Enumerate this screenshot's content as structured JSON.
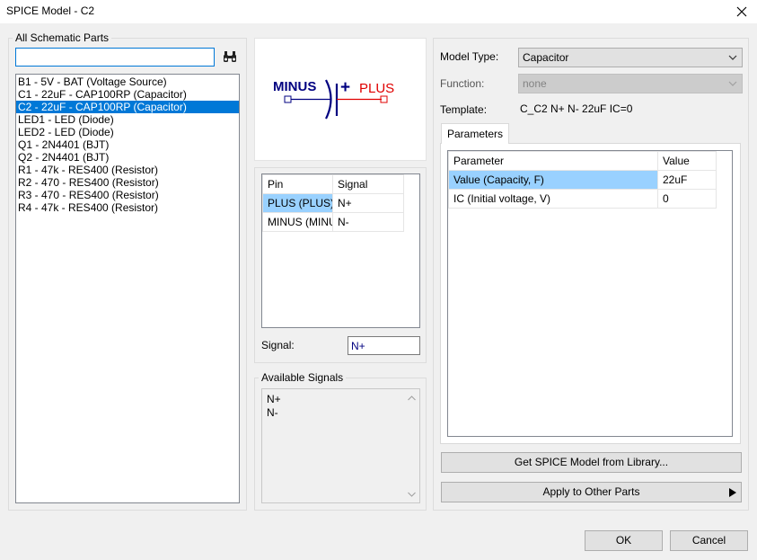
{
  "window": {
    "title": "SPICE Model - C2"
  },
  "left_panel": {
    "label": "All Schematic Parts",
    "search_value": "",
    "parts": [
      "B1 - 5V - BAT (Voltage Source)",
      "C1 - 22uF - CAP100RP (Capacitor)",
      "C2 - 22uF - CAP100RP (Capacitor)",
      "LED1 - LED (Diode)",
      "LED2 - LED (Diode)",
      "Q1 - 2N4401 (BJT)",
      "Q2 - 2N4401 (BJT)",
      "R1 - 47k - RES400 (Resistor)",
      "R2 - 470 - RES400 (Resistor)",
      "R3 - 470 - RES400 (Resistor)",
      "R4 - 47k - RES400 (Resistor)"
    ],
    "selected_index": 2
  },
  "symbol": {
    "minus_label": "MINUS",
    "plus_label": "PLUS",
    "plus_sign": "+"
  },
  "pins": {
    "columns": [
      "Pin",
      "Signal"
    ],
    "rows": [
      {
        "pin": "PLUS (PLUS)",
        "signal": "N+"
      },
      {
        "pin": "MINUS (MINUS)",
        "signal": "N-"
      }
    ],
    "signal_label": "Signal:",
    "signal_value": "N+"
  },
  "available_signals": {
    "label": "Available Signals",
    "items": [
      "N+",
      "N-"
    ]
  },
  "model": {
    "model_type_label": "Model Type:",
    "model_type_value": "Capacitor",
    "function_label": "Function:",
    "function_value": "none",
    "template_label": "Template:",
    "template_value": "C_C2 N+ N- 22uF IC=0"
  },
  "parameters": {
    "tab_label": "Parameters",
    "columns": [
      "Parameter",
      "Value"
    ],
    "rows": [
      {
        "name": "Value (Capacity, F)",
        "value": "22uF"
      },
      {
        "name": "IC (Initial voltage, V)",
        "value": "0"
      }
    ]
  },
  "buttons": {
    "get_model": "Get SPICE Model from Library...",
    "apply_other": "Apply to Other Parts",
    "ok": "OK",
    "cancel": "Cancel"
  },
  "colors": {
    "selection": "#0078d7",
    "cell_selection": "#99d1ff",
    "plus_red": "#e00000",
    "symbol_blue": "#000080"
  }
}
